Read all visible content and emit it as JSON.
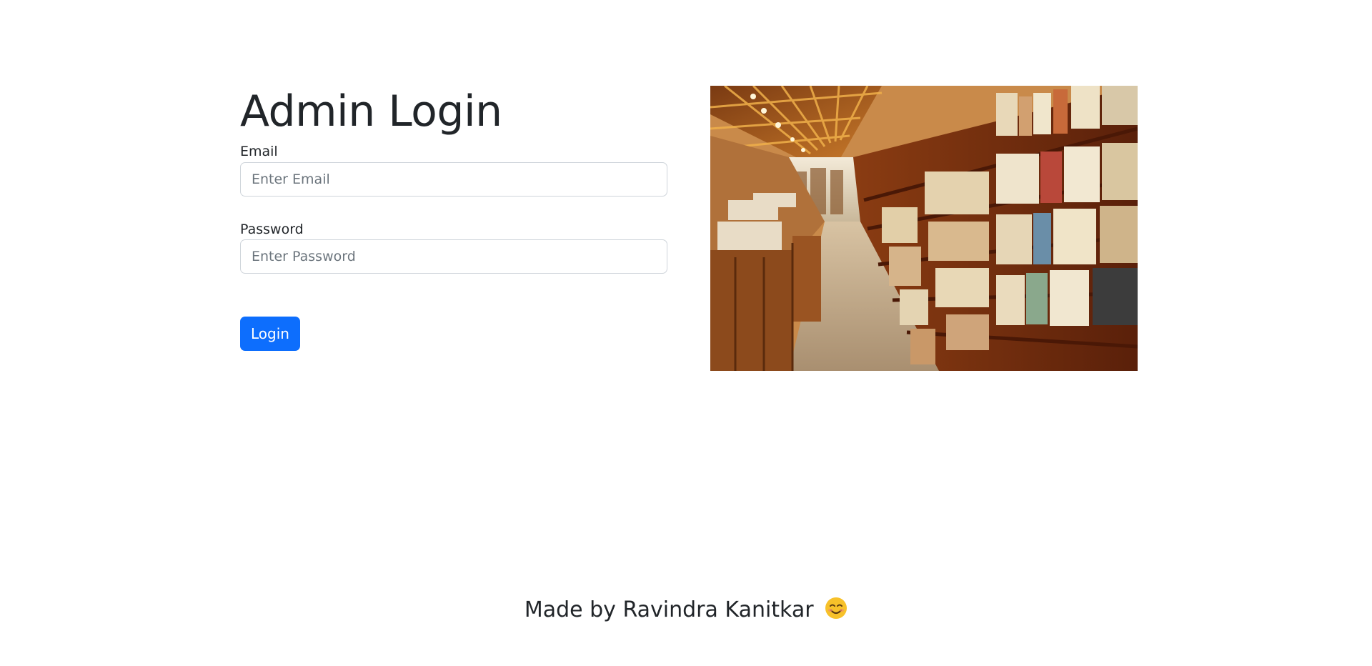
{
  "login": {
    "title": "Admin Login",
    "email_label": "Email",
    "email_placeholder": "Enter Email",
    "email_value": "",
    "password_label": "Password",
    "password_placeholder": "Enter Password",
    "password_value": "",
    "button_label": "Login"
  },
  "hero": {
    "image_name": "library-bookshelves-photo"
  },
  "footer": {
    "text": "Made by Ravindra Kanitkar",
    "emoji_icon": "smiling-face-icon"
  },
  "colors": {
    "primary": "#0d6efd",
    "text": "#212529",
    "placeholder": "#6c757d",
    "input_border": "#ced4da"
  }
}
